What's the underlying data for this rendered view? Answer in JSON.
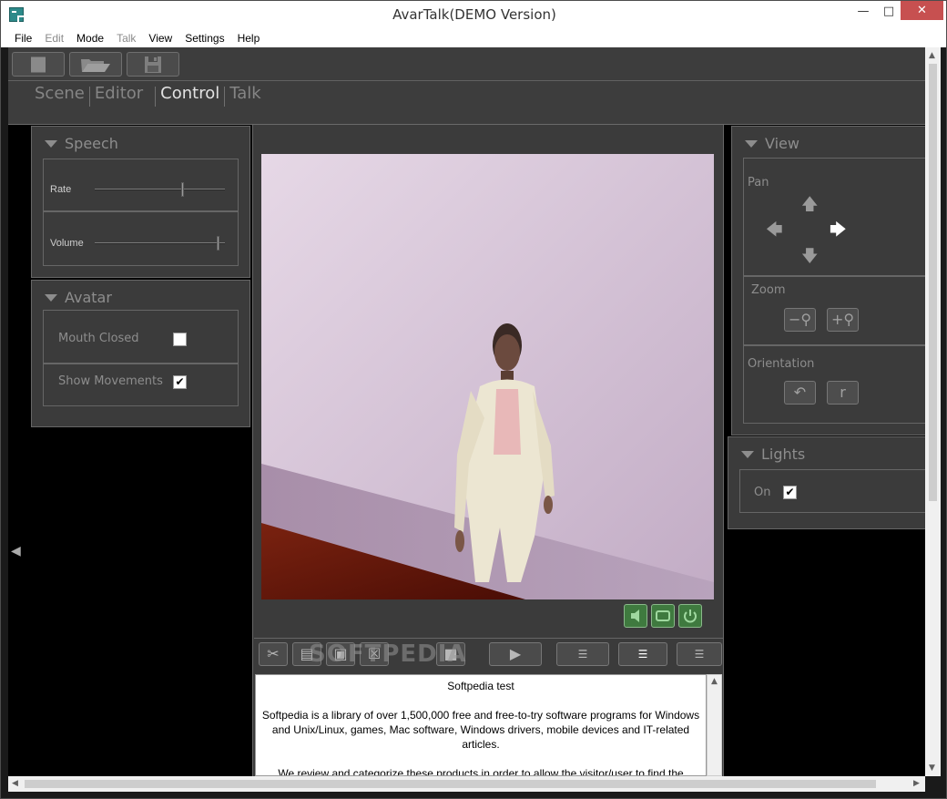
{
  "window": {
    "title": "AvarTalk(DEMO Version)"
  },
  "menu": [
    "File",
    "Edit",
    "Mode",
    "Talk",
    "View",
    "Settings",
    "Help"
  ],
  "modes": {
    "scene": "Scene",
    "editor": "Editor",
    "control": "Control",
    "talk": "Talk",
    "active": "Control"
  },
  "speech": {
    "title": "Speech",
    "rate_label": "Rate",
    "rate_value": 0.68,
    "volume_label": "Volume",
    "volume_value": 0.95
  },
  "avatar": {
    "title": "Avatar",
    "mouth_closed_label": "Mouth Closed",
    "mouth_closed": false,
    "show_movements_label": "Show Movements",
    "show_movements": true
  },
  "view": {
    "title": "View",
    "pan_label": "Pan",
    "zoom_label": "Zoom",
    "orientation_label": "Orientation"
  },
  "lights": {
    "title": "Lights",
    "on_label": "On",
    "on": true
  },
  "check_mark": "✔",
  "script_text": {
    "title": "Softpedia test",
    "p1": "Softpedia is a library of over 1,500,000 free and free-to-try software programs for Windows and Unix/Linux, games, Mac software, Windows drivers, mobile devices and IT-related articles.",
    "p2": "We review and categorize these products in order to allow the visitor/user to find the"
  },
  "watermark": "SOFTPEDIA",
  "colors": {
    "background": "#000000",
    "panel": "#3b3b3b",
    "accent_green": "#3f7a3f",
    "floor": "#6b1a0a",
    "wall": "#d7c4d8"
  }
}
